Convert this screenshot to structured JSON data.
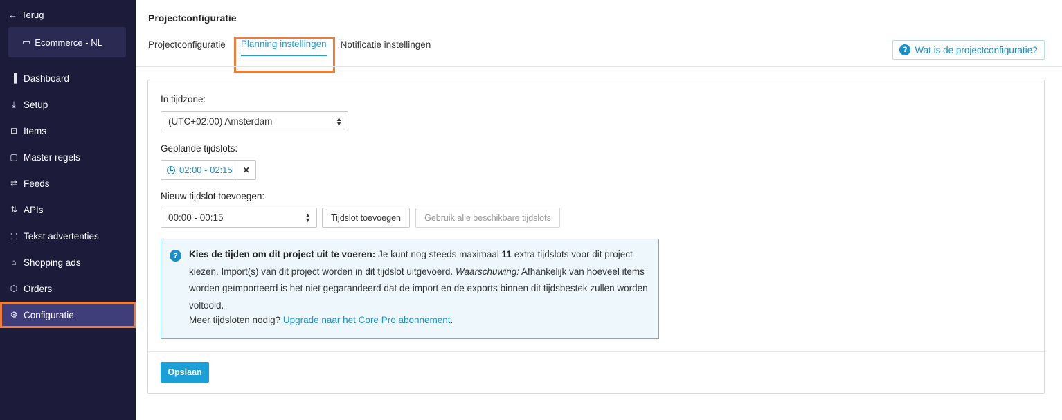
{
  "sidebar": {
    "back_label": "Terug",
    "project_name": "Ecommerce - NL",
    "items": [
      {
        "label": "Dashboard",
        "icon": "bar-chart-icon",
        "glyph": "▐"
      },
      {
        "label": "Setup",
        "icon": "download-tray-icon",
        "glyph": "⤓"
      },
      {
        "label": "Items",
        "icon": "cart-icon",
        "glyph": "⊡"
      },
      {
        "label": "Master regels",
        "icon": "clipboard-icon",
        "glyph": "▢"
      },
      {
        "label": "Feeds",
        "icon": "feeds-icon",
        "glyph": "⇄"
      },
      {
        "label": "APIs",
        "icon": "sort-arrows-icon",
        "glyph": "⇅"
      },
      {
        "label": "Tekst advertenties",
        "icon": "brackets-icon",
        "glyph": "⸬"
      },
      {
        "label": "Shopping ads",
        "icon": "shopping-bag-icon",
        "glyph": "⌂"
      },
      {
        "label": "Orders",
        "icon": "box-icon",
        "glyph": "⬡"
      },
      {
        "label": "Configuratie",
        "icon": "gear-icon",
        "glyph": "⚙"
      }
    ],
    "active_index": 9
  },
  "header": {
    "title": "Projectconfiguratie",
    "tabs": [
      {
        "label": "Projectconfiguratie"
      },
      {
        "label": "Planning instellingen"
      },
      {
        "label": "Notificatie instellingen"
      }
    ],
    "active_tab": 1,
    "help_link": "Wat is de projectconfiguratie?"
  },
  "form": {
    "timezone_label": "In tijdzone:",
    "timezone_value": "(UTC+02:00) Amsterdam",
    "slots_label": "Geplande tijdslots:",
    "slots": [
      "02:00 - 02:15"
    ],
    "new_slot_label": "Nieuw tijdslot toevoegen:",
    "new_slot_value": "00:00 - 00:15",
    "add_slot_button": "Tijdslot toevoegen",
    "use_all_button": "Gebruik alle beschikbare tijdslots",
    "info": {
      "bold_intro": "Kies de tijden om dit project uit te voeren:",
      "text1": "Je kunt nog steeds maximaal",
      "count": "11",
      "text2": "extra tijdslots voor dit project kiezen. Import(s) van dit project worden in dit tijdslot uitgevoerd.",
      "warning_label": "Waarschuwing:",
      "text3": "Afhankelijk van hoeveel items worden geïmporteerd is het niet gegarandeerd dat de import en de exports binnen dit tijdsbestek zullen worden voltooid.",
      "more_text": "Meer tijdsloten nodig?",
      "upgrade_link": "Upgrade naar het Core Pro abonnement",
      "period": "."
    },
    "save_button": "Opslaan"
  }
}
